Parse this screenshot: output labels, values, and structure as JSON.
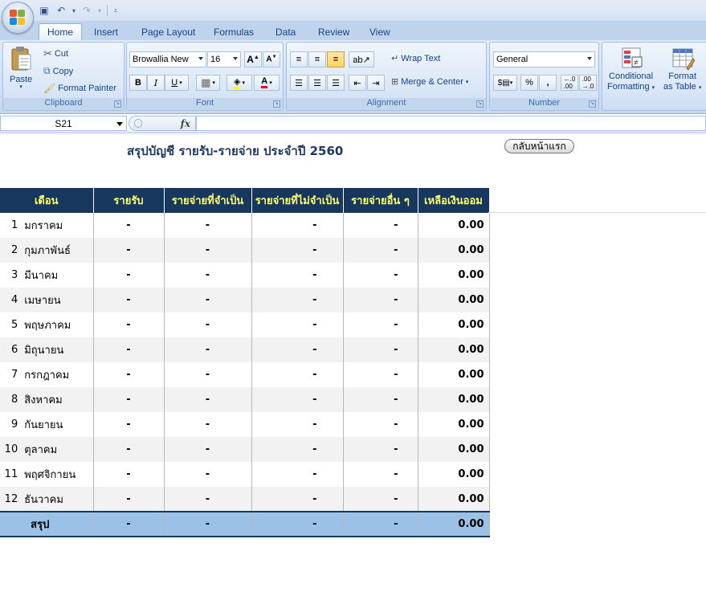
{
  "qat": {
    "save": "💾",
    "undo": "↶",
    "redo": "↷"
  },
  "tabs": [
    "Home",
    "Insert",
    "Page Layout",
    "Formulas",
    "Data",
    "Review",
    "View"
  ],
  "ribbon": {
    "clipboard": {
      "label": "Clipboard",
      "paste": "Paste",
      "cut": "Cut",
      "copy": "Copy",
      "format_painter": "Format Painter"
    },
    "font": {
      "label": "Font",
      "family": "Browallia New",
      "size": "16"
    },
    "alignment": {
      "label": "Alignment",
      "wrap_text": "Wrap Text",
      "merge_center": "Merge & Center"
    },
    "number": {
      "label": "Number",
      "format": "General"
    },
    "styles": {
      "conditional_formatting_1": "Conditional",
      "conditional_formatting_2": "Formatting",
      "format_table_1": "Format",
      "format_table_2": "as Table"
    }
  },
  "formula_bar": {
    "name_box": "S21",
    "fx": "fx",
    "value": ""
  },
  "sheet": {
    "title": "สรุปบัญชี รายรับ-รายจ่าย ประจำปี 2560",
    "back_button": "กลับหน้าแรก",
    "headers": [
      "เดือน",
      "รายรับ",
      "รายจ่ายที่จำเป็น",
      "รายจ่ายที่ไม่จำเป็น",
      "รายจ่ายอื่น ๆ",
      "เหลือเงินออม"
    ],
    "rows": [
      {
        "no": "1",
        "month": "มกราคม",
        "income": "-",
        "necessary": "-",
        "unnecessary": "-",
        "other": "-",
        "savings": "0.00"
      },
      {
        "no": "2",
        "month": "กุมภาพันธ์",
        "income": "-",
        "necessary": "-",
        "unnecessary": "-",
        "other": "-",
        "savings": "0.00"
      },
      {
        "no": "3",
        "month": "มีนาคม",
        "income": "-",
        "necessary": "-",
        "unnecessary": "-",
        "other": "-",
        "savings": "0.00"
      },
      {
        "no": "4",
        "month": "เมษายน",
        "income": "-",
        "necessary": "-",
        "unnecessary": "-",
        "other": "-",
        "savings": "0.00"
      },
      {
        "no": "5",
        "month": "พฤษภาคม",
        "income": "-",
        "necessary": "-",
        "unnecessary": "-",
        "other": "-",
        "savings": "0.00"
      },
      {
        "no": "6",
        "month": "มิถุนายน",
        "income": "-",
        "necessary": "-",
        "unnecessary": "-",
        "other": "-",
        "savings": "0.00"
      },
      {
        "no": "7",
        "month": "กรกฎาคม",
        "income": "-",
        "necessary": "-",
        "unnecessary": "-",
        "other": "-",
        "savings": "0.00"
      },
      {
        "no": "8",
        "month": "สิงหาคม",
        "income": "-",
        "necessary": "-",
        "unnecessary": "-",
        "other": "-",
        "savings": "0.00"
      },
      {
        "no": "9",
        "month": "กันยายน",
        "income": "-",
        "necessary": "-",
        "unnecessary": "-",
        "other": "-",
        "savings": "0.00"
      },
      {
        "no": "10",
        "month": "ตุลาคม",
        "income": "-",
        "necessary": "-",
        "unnecessary": "-",
        "other": "-",
        "savings": "0.00"
      },
      {
        "no": "11",
        "month": "พฤศจิกายน",
        "income": "-",
        "necessary": "-",
        "unnecessary": "-",
        "other": "-",
        "savings": "0.00"
      },
      {
        "no": "12",
        "month": "ธันวาคม",
        "income": "-",
        "necessary": "-",
        "unnecessary": "-",
        "other": "-",
        "savings": "0.00"
      }
    ],
    "total": {
      "label": "สรุป",
      "income": "-",
      "necessary": "-",
      "unnecessary": "-",
      "other": "-",
      "savings": "0.00"
    }
  }
}
